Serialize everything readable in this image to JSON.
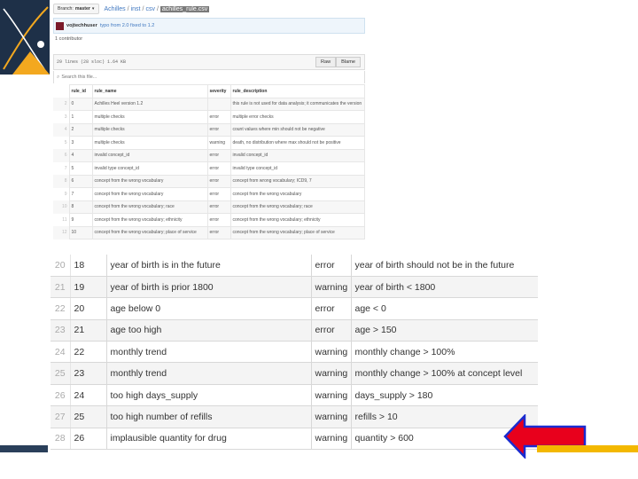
{
  "colors": {
    "logo_navy": "#1e3048",
    "logo_orange": "#f3a81f",
    "bar_navy": "#2a3f5a",
    "bar_gold": "#f3b800",
    "arrow_fill": "#e8001c",
    "arrow_outline": "#1a2bd0",
    "link_blue": "#4078c0"
  },
  "github": {
    "branch_label": "Branch:",
    "branch_name": "master",
    "path_parts": [
      "Achilles",
      "inst",
      "csv"
    ],
    "file_name": "achilles_rule.csv",
    "commit_author": "vojtechhuser",
    "commit_message": "typo from 2.0 fixed to 1.2",
    "contributors": "1 contributor",
    "file_meta": "29 lines (28 sloc)   1.64 KB",
    "raw_button": "Raw",
    "blame_button": "Blame",
    "search_placeholder": "Search this file...",
    "headers": [
      "rule_id",
      "rule_name",
      "severity",
      "rule_description"
    ],
    "rows": [
      {
        "ln": "2",
        "id": "0",
        "name": "Achilles Heel version 1.2",
        "sev": "",
        "desc": "this rule is not used for data analysis; it communicates the version"
      },
      {
        "ln": "3",
        "id": "1",
        "name": "multiple checks",
        "sev": "error",
        "desc": "multiple error checks"
      },
      {
        "ln": "4",
        "id": "2",
        "name": "multiple checks",
        "sev": "error",
        "desc": "count values where min should not be negative"
      },
      {
        "ln": "5",
        "id": "3",
        "name": "multiple checks",
        "sev": "warning",
        "desc": "death, no distribution where max should not be positive"
      },
      {
        "ln": "6",
        "id": "4",
        "name": "invalid concept_id",
        "sev": "error",
        "desc": "invalid concept_id"
      },
      {
        "ln": "7",
        "id": "5",
        "name": "invalid type concept_id",
        "sev": "error",
        "desc": "invalid type concept_id"
      },
      {
        "ln": "8",
        "id": "6",
        "name": "concept from the wrong vocabulary",
        "sev": "error",
        "desc": "concept from wrong vocabulary; ICD9, 7"
      },
      {
        "ln": "9",
        "id": "7",
        "name": "concept from the wrong vocabulary",
        "sev": "error",
        "desc": "concept from the wrong vocabulary"
      },
      {
        "ln": "10",
        "id": "8",
        "name": "concept from the wrong vocabulary; race",
        "sev": "error",
        "desc": "concept from the wrong vocabulary; race"
      },
      {
        "ln": "11",
        "id": "9",
        "name": "concept from the wrong vocabulary; ethnicity",
        "sev": "error",
        "desc": "concept from the wrong vocabulary; ethnicity"
      },
      {
        "ln": "12",
        "id": "10",
        "name": "concept from the wrong vocabulary; place of service",
        "sev": "error",
        "desc": "concept from the wrong vocabulary; place of service"
      }
    ]
  },
  "zoom": {
    "rows": [
      {
        "ln": "20",
        "id": "18",
        "name": "year of birth is in the future",
        "sev": "error",
        "desc": "year of birth should not be in the future"
      },
      {
        "ln": "21",
        "id": "19",
        "name": "year of birth is prior 1800",
        "sev": "warning",
        "desc": "year of birth < 1800"
      },
      {
        "ln": "22",
        "id": "20",
        "name": "age below 0",
        "sev": "error",
        "desc": "age < 0"
      },
      {
        "ln": "23",
        "id": "21",
        "name": "age too high",
        "sev": "error",
        "desc": "age > 150"
      },
      {
        "ln": "24",
        "id": "22",
        "name": "monthly trend",
        "sev": "warning",
        "desc": "monthly change > 100%"
      },
      {
        "ln": "25",
        "id": "23",
        "name": "monthly trend",
        "sev": "warning",
        "desc": "monthly change > 100% at concept level"
      },
      {
        "ln": "26",
        "id": "24",
        "name": "too high days_supply",
        "sev": "warning",
        "desc": "days_supply > 180"
      },
      {
        "ln": "27",
        "id": "25",
        "name": "too high number of refills",
        "sev": "warning",
        "desc": "refills > 10"
      },
      {
        "ln": "28",
        "id": "26",
        "name": "implausible quantity for drug",
        "sev": "warning",
        "desc": "quantity > 600"
      }
    ]
  }
}
